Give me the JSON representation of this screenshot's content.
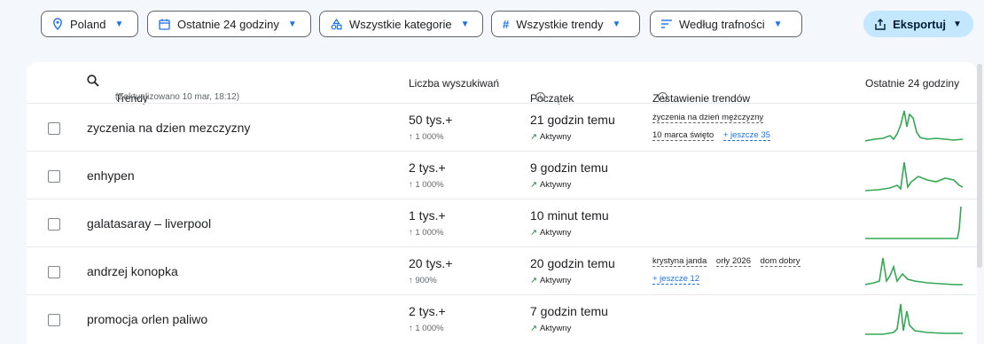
{
  "filters": {
    "country": "Poland",
    "time": "Ostatnie 24 godziny",
    "category": "Wszystkie kategorie",
    "trends": "Wszystkie trendy",
    "sort": "Według trafności"
  },
  "export_label": "Eksportuj",
  "header": {
    "trends": "Trendy",
    "updated": "(Zaktualizowano 10 mar, 18:12)",
    "volume": "Liczba wyszukiwań",
    "start": "Początek",
    "breakdown": "Zestawienie trendów",
    "last24": "Ostatnie 24 godziny"
  },
  "rows": [
    {
      "term": "zyczenia na dzien mezczyzny",
      "volume": "50 tys.+",
      "change": "↑ 1 000%",
      "start": "21 godzin temu",
      "status": "Aktywny",
      "breakdown": [
        "życzenia na dzień mężczyzny"
      ],
      "breakdown2": [
        "10 marca święto"
      ],
      "more": "+ jeszcze 35"
    },
    {
      "term": "enhypen",
      "volume": "2 tys.+",
      "change": "↑ 1 000%",
      "start": "9 godzin temu",
      "status": "Aktywny",
      "breakdown": [],
      "breakdown2": [],
      "more": ""
    },
    {
      "term": "galatasaray – liverpool",
      "volume": "1 tys.+",
      "change": "↑ 1 000%",
      "start": "10 minut temu",
      "status": "Aktywny",
      "breakdown": [],
      "breakdown2": [],
      "more": ""
    },
    {
      "term": "andrzej konopka",
      "volume": "20 tys.+",
      "change": "↑ 900%",
      "start": "20 godzin temu",
      "status": "Aktywny",
      "breakdown": [
        "krystyna janda",
        "orły 2026",
        "dom dobry"
      ],
      "breakdown2": [],
      "more": "+ jeszcze 12"
    },
    {
      "term": "promocja orlen paliwo",
      "volume": "2 tys.+",
      "change": "↑ 1 000%",
      "start": "7 godzin temu",
      "status": "Aktywny",
      "breakdown": [],
      "breakdown2": [],
      "more": ""
    }
  ],
  "colors": {
    "accent": "#1a73e8",
    "spark": "#34a853",
    "export_bg": "#c2e7ff"
  },
  "icons": [
    "location-pin-icon",
    "calendar-icon",
    "category-icon",
    "hashtag-icon",
    "sort-icon",
    "export-icon",
    "search-icon",
    "info-icon",
    "trending-up-icon"
  ]
}
